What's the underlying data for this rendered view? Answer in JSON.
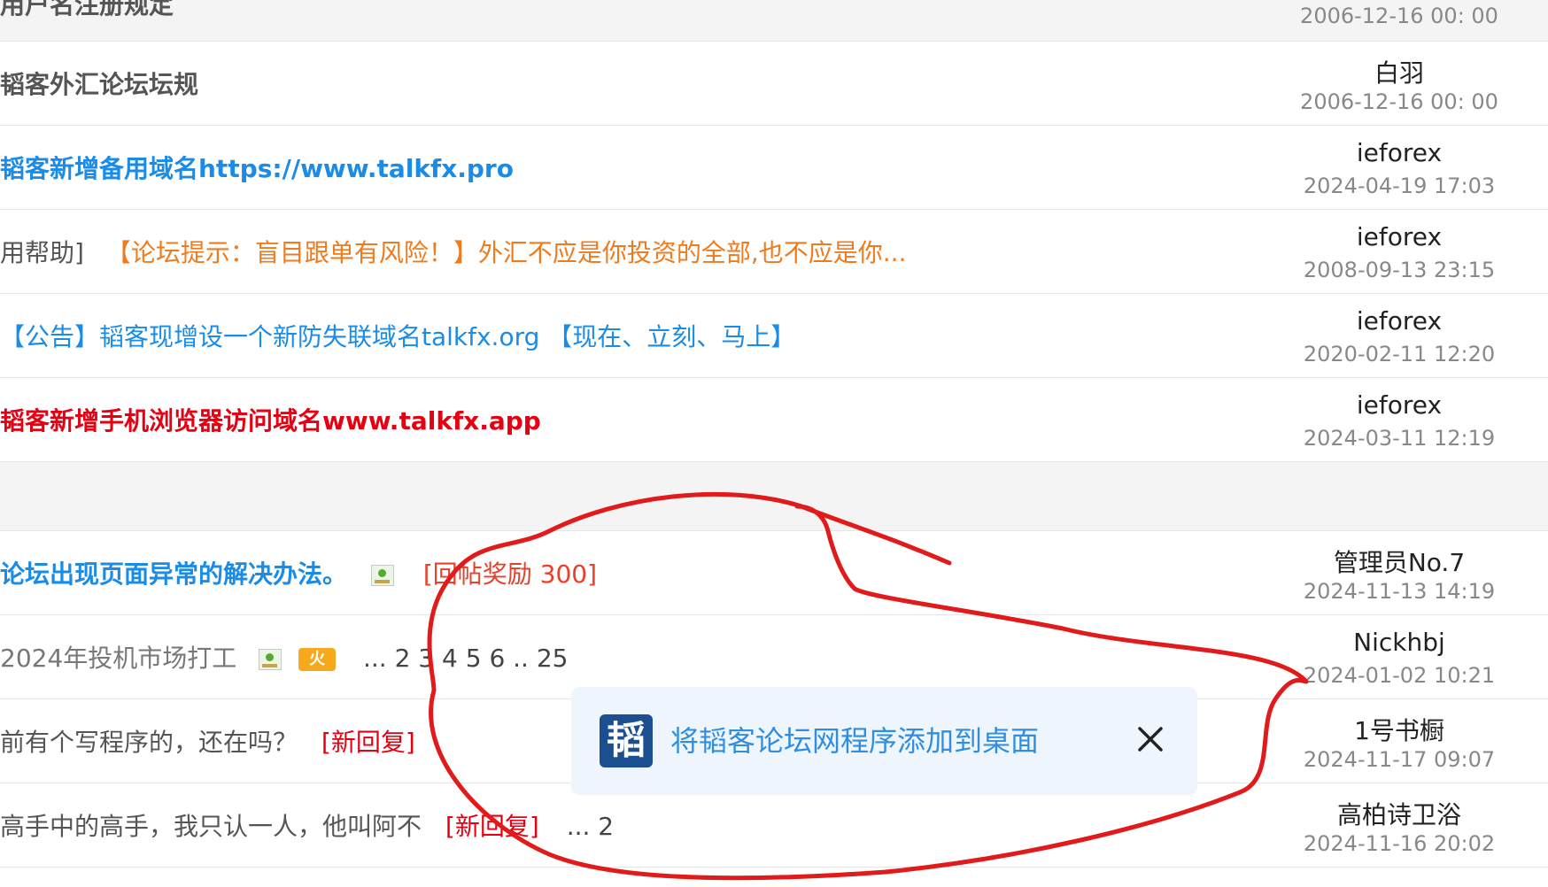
{
  "colors": {
    "blue": "#1a8ce8",
    "orange": "#f07b1c",
    "red": "#e60012",
    "annotation": "#e11b1b",
    "toast_bg": "#eef5fc",
    "logo_bg": "#1b4f8f"
  },
  "threads": [
    {
      "title": "用户名注册规定",
      "author": "",
      "date": "2006-12-16 00: 00"
    },
    {
      "title": "韬客外汇论坛坛规",
      "author": "白羽",
      "date": "2006-12-16 00: 00"
    },
    {
      "title": "韬客新增备用域名https://www.talkfx.pro",
      "author": "ieforex",
      "date": "2024-04-19 17:03"
    },
    {
      "prefix": "用帮助]",
      "title": "【论坛提示：盲目跟单有风险！】外汇不应是你投资的全部,也不应是你...",
      "author": "ieforex",
      "date": "2008-09-13 23:15"
    },
    {
      "title": "【公告】韬客现增设一个新防失联域名talkfx.org 【现在、立刻、马上】",
      "author": "ieforex",
      "date": "2020-02-11 12:20"
    },
    {
      "title": "韬客新增手机浏览器访问域名www.talkfx.app",
      "author": "ieforex",
      "date": "2024-03-11 12:19"
    },
    {
      "title": "论坛出现页面异常的解决办法。",
      "tag": "[回帖奖励 300]",
      "icon": "image-attachment-icon",
      "author": "管理员No.7",
      "date": "2024-11-13 14:19"
    },
    {
      "title": "2024年投机市场打工",
      "icons": [
        "image-attachment-icon",
        "hot-icon"
      ],
      "hot_label": "火",
      "pager": "... 2 3 4 5 6 .. 25",
      "author": "Nickhbj",
      "date": "2024-01-02 10:21"
    },
    {
      "title": "前有个写程序的，还在吗？",
      "tag": "[新回复]",
      "author": "1号书橱",
      "date": "2024-11-17 09:07"
    },
    {
      "title": "高手中的高手，我只认一人，他叫阿不",
      "tag": "[新回复]",
      "pager": "... 2",
      "author": "高柏诗卫浴",
      "date": "2024-11-16 20:02"
    }
  ],
  "toast": {
    "logo_char": "韬",
    "text": "将韬客论坛网程序添加到桌面",
    "close_icon": "close-icon"
  }
}
